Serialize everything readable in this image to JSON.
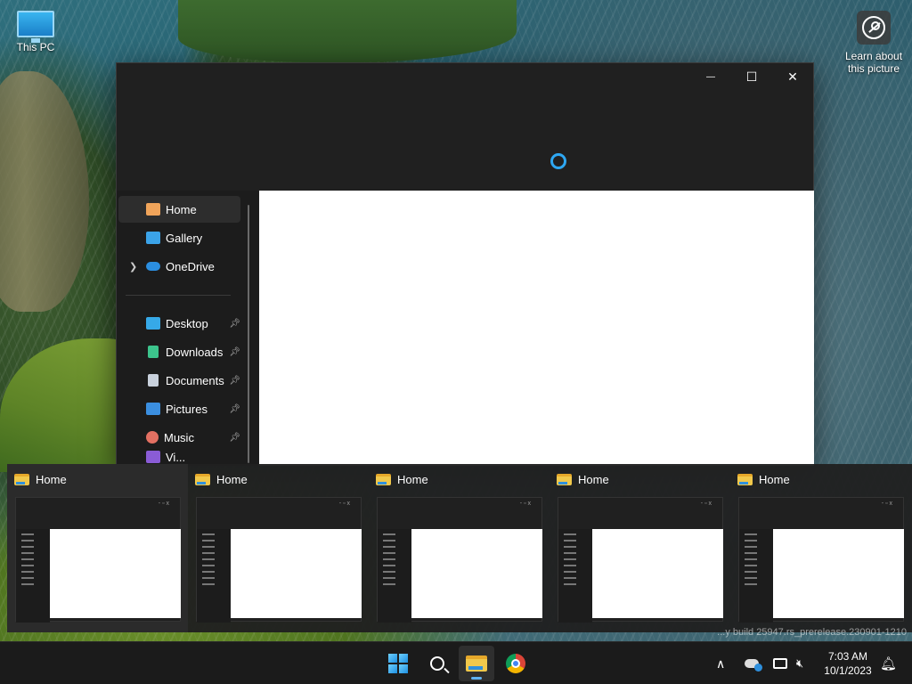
{
  "desktop": {
    "this_pc_label": "This PC",
    "learn_label": "Learn about this picture"
  },
  "window": {
    "minimize_glyph": "—",
    "maximize_glyph": "☐",
    "close_glyph": "✕",
    "nav_items": [
      {
        "label": "Home",
        "icon": "home-icon",
        "color": "#f0a45a"
      },
      {
        "label": "Gallery",
        "icon": "gallery-icon",
        "color": "#3ba3e8"
      },
      {
        "label": "OneDrive",
        "icon": "onedrive-icon",
        "color": "#2b8ee0"
      },
      {
        "label": "Desktop",
        "icon": "desktop-icon",
        "color": "#36a9e8"
      },
      {
        "label": "Downloads",
        "icon": "downloads-icon",
        "color": "#3cc48c"
      },
      {
        "label": "Documents",
        "icon": "documents-icon",
        "color": "#c9d1dc"
      },
      {
        "label": "Pictures",
        "icon": "pictures-icon",
        "color": "#3b8fe0"
      },
      {
        "label": "Music",
        "icon": "music-icon",
        "color": "#e37062"
      },
      {
        "label": "Vi...",
        "icon": "videos-icon",
        "color": "#8a5cd6"
      }
    ]
  },
  "task_switcher": {
    "items": [
      {
        "title": "Home"
      },
      {
        "title": "Home"
      },
      {
        "title": "Home"
      },
      {
        "title": "Home"
      },
      {
        "title": "Home"
      }
    ]
  },
  "watermark": "...y build 25947.rs_prerelease.230901-1210",
  "taskbar": {
    "time": "7:03 AM",
    "date": "10/1/2023"
  }
}
